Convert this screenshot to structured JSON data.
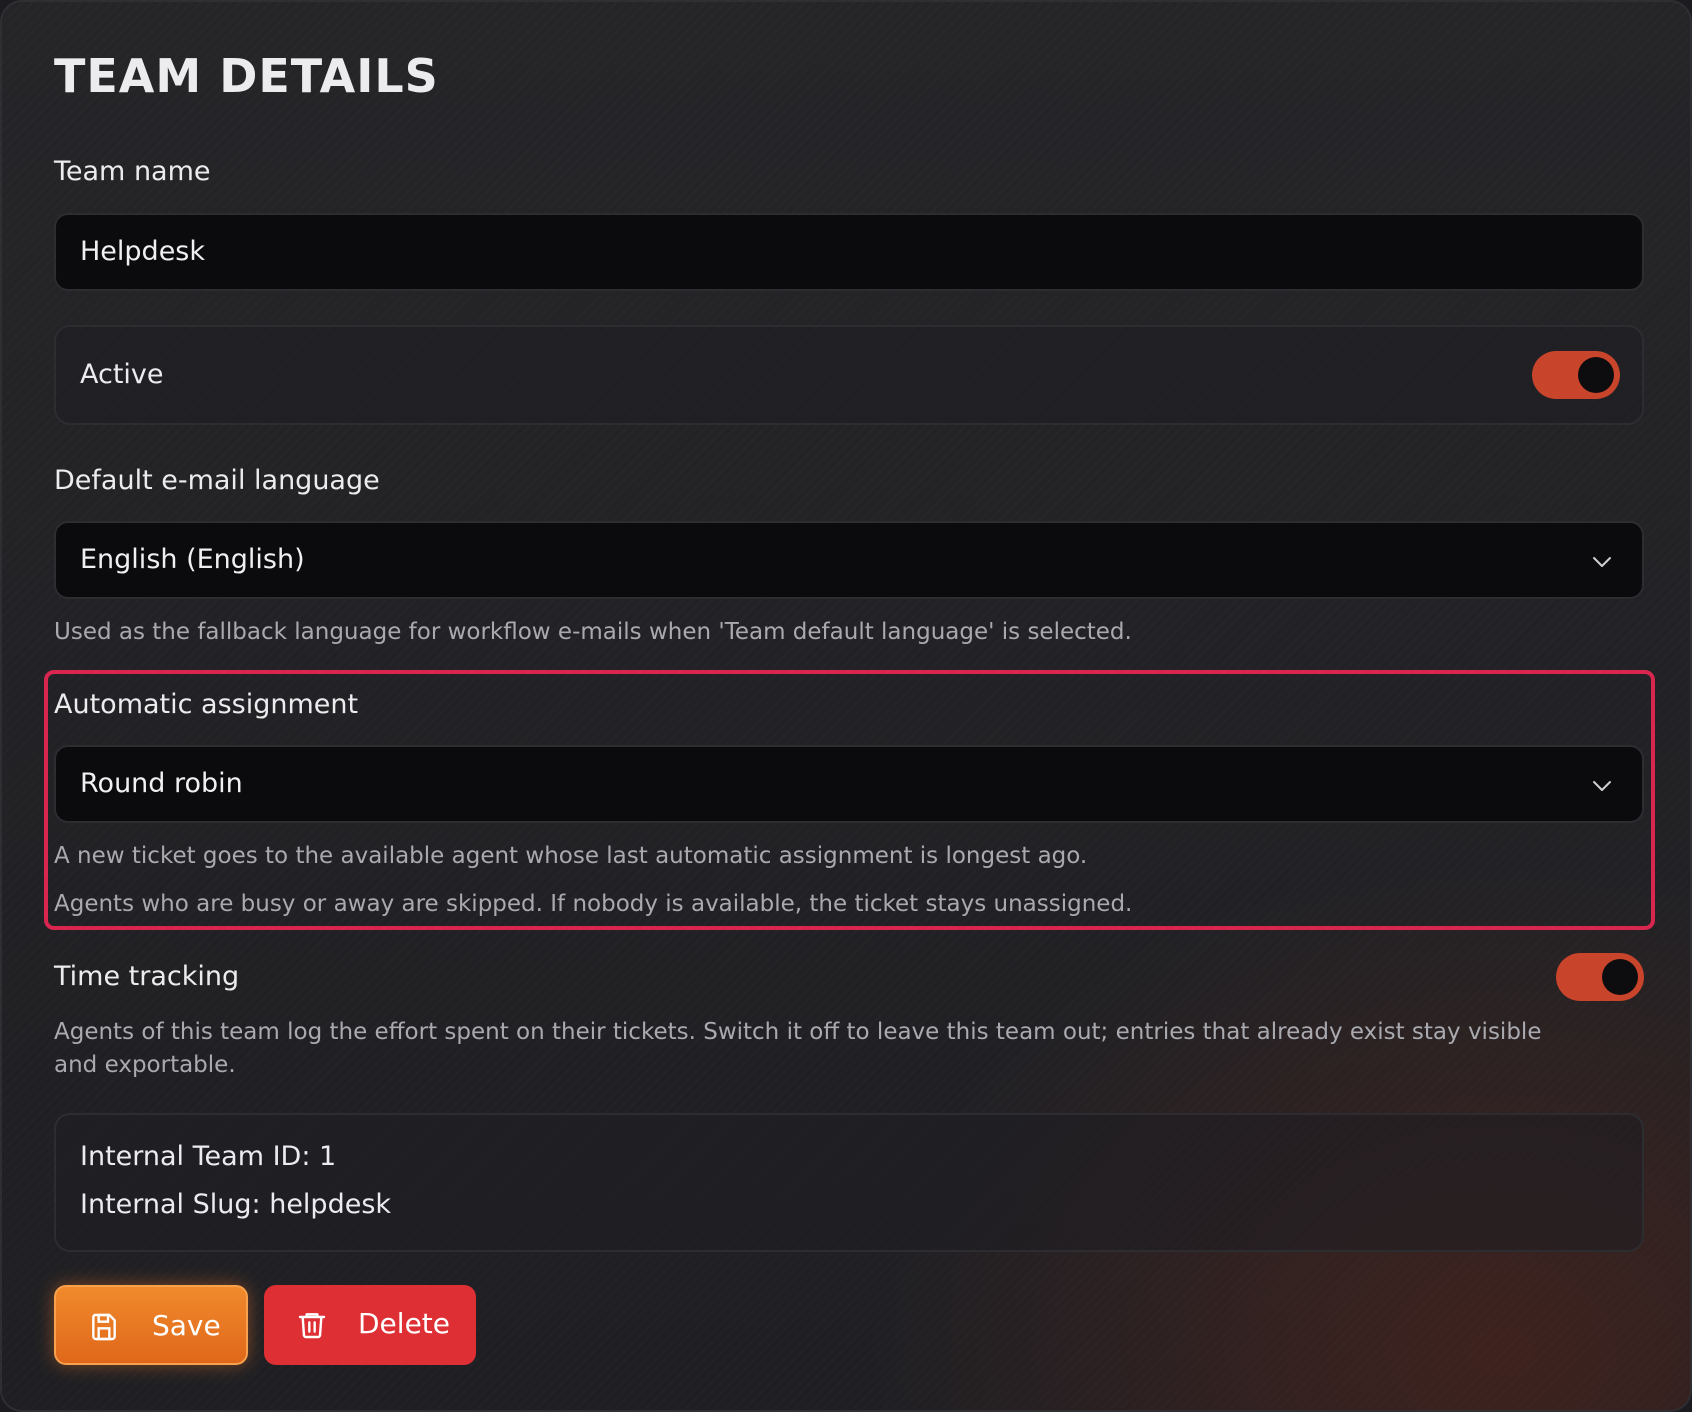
{
  "page": {
    "title": "TEAM DETAILS"
  },
  "team_name": {
    "label": "Team name",
    "value": "Helpdesk"
  },
  "active": {
    "label": "Active",
    "enabled": true
  },
  "email_language": {
    "label": "Default e-mail language",
    "selected": "English (English)",
    "help": "Used as the fallback language for workflow e-mails when 'Team default language' is selected."
  },
  "assignment": {
    "label": "Automatic assignment",
    "selected": "Round robin",
    "help_line1": "A new ticket goes to the available agent whose last automatic assignment is longest ago.",
    "help_line2": "Agents who are busy or away are skipped. If nobody is available, the ticket stays unassigned."
  },
  "time_tracking": {
    "label": "Time tracking",
    "enabled": true,
    "help": "Agents of this team log the effort spent on their tickets. Switch it off to leave this team out; entries that already exist stay visible and exportable."
  },
  "internal": {
    "team_id": "Internal Team ID: 1",
    "slug": "Internal Slug: helpdesk"
  },
  "actions": {
    "save_label": "Save",
    "delete_label": "Delete",
    "save_icon": "floppy-disk-icon",
    "delete_icon": "trash-icon"
  },
  "colors": {
    "toggle_on": "#c8442b",
    "highlight_border": "#d8264f",
    "save_button": "#e9781f",
    "delete_button": "#de2f35"
  }
}
